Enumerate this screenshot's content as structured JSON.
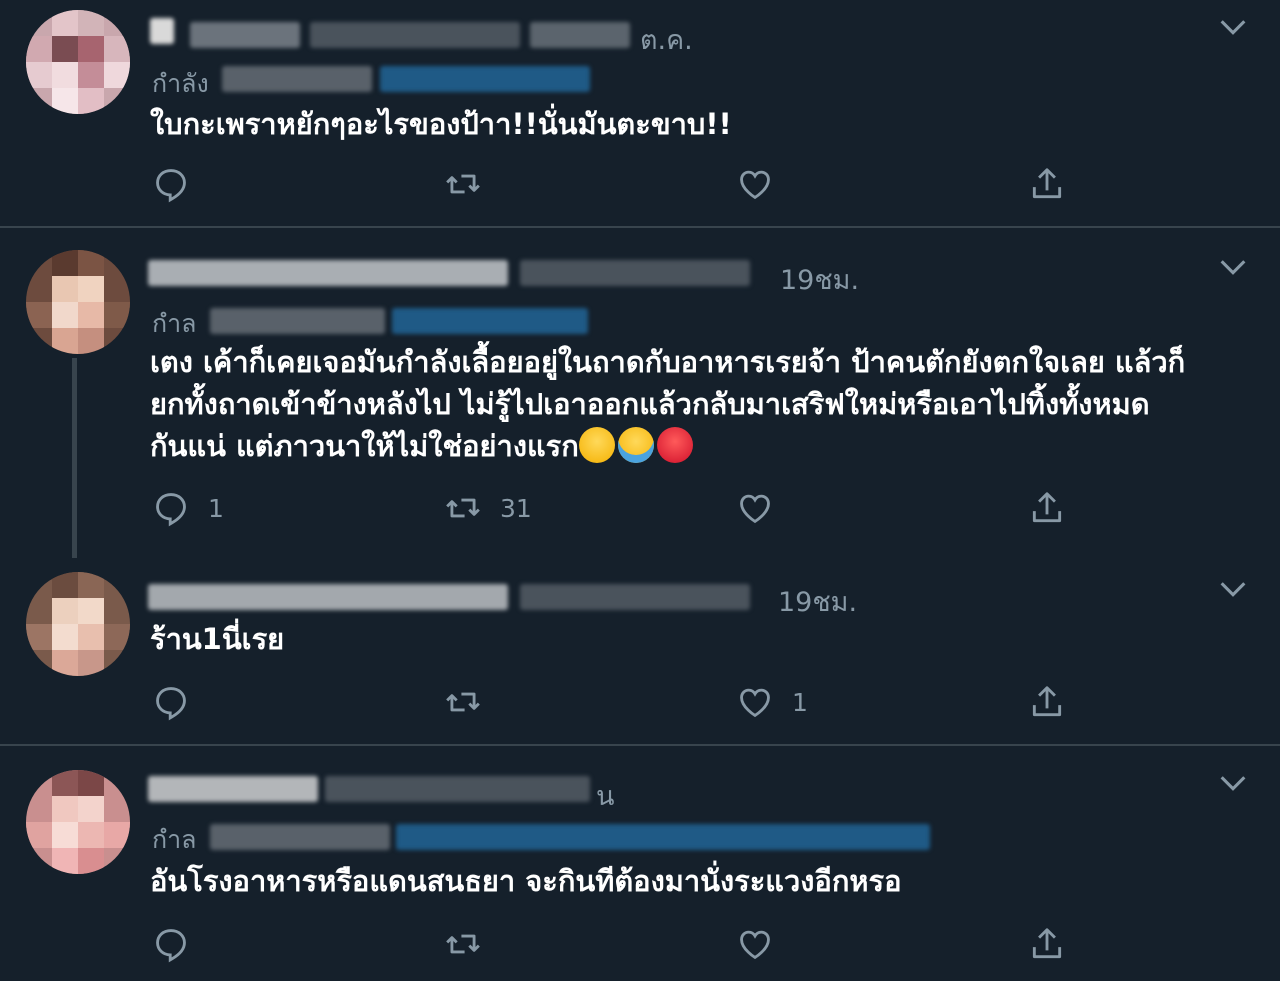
{
  "colors": {
    "background": "#15202b",
    "text": "#ffffff",
    "muted": "#8899a6",
    "divider": "#38444d",
    "link": "#1da1f2"
  },
  "tweets": [
    {
      "time": "ต.ค.",
      "reply_prefix": "กำลัง",
      "text": "ใบกะเพราหยักๆอะไรของป้าา!!นั่นมันตะขาบ!!",
      "replies": "",
      "retweets": "",
      "likes": ""
    },
    {
      "time": "19ชม.",
      "reply_prefix": "กำล",
      "text": "เตง เค้าก็เคยเจอมันกำลังเลื้อยอยู่ในถาดกับอาหารเรยจ้า ป้าคนตักยังตกใจเลย แล้วก็\nยกทั้งถาดเข้าข้างหลังไป ไม่รู้ไปเอาออกแล้วกลับมาเสริฟใหม่หรือเอาไปทิ้งทั้งหมด\nกันแน่ แต่ภาวนาให้ไม่ใช่อย่างแรก",
      "emojis": [
        "crying-face",
        "loudly-crying-face",
        "angry-face"
      ],
      "replies": "1",
      "retweets": "31",
      "likes": ""
    },
    {
      "time": "19ชม.",
      "text": "ร้าน1นี่เรย",
      "replies": "",
      "retweets": "",
      "likes": "1"
    },
    {
      "time": "น",
      "reply_prefix": "กำล",
      "text": "อันโรงอาหารหรือแดนสนธยา จะกินทีต้องมานั่งระแวงอีกหรอ",
      "replies": "",
      "retweets": "",
      "likes": ""
    }
  ],
  "icons": {
    "reply": "reply-icon",
    "retweet": "retweet-icon",
    "like": "heart-icon",
    "share": "share-icon",
    "more": "chevron-down-icon"
  }
}
